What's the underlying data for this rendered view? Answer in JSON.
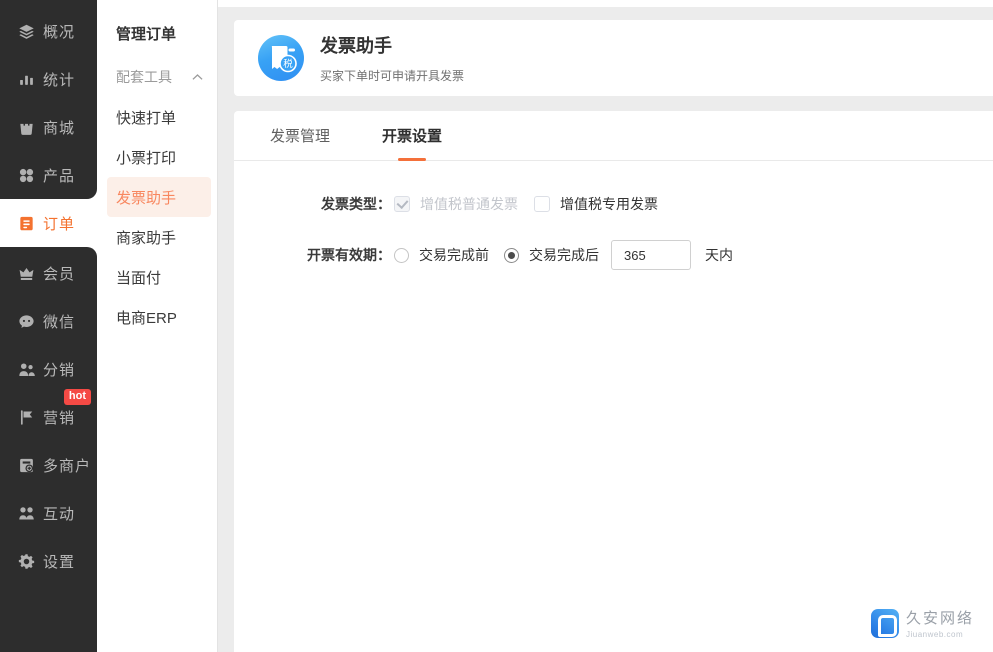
{
  "sidebar": {
    "items": [
      {
        "label": "概况",
        "icon": "layers-icon"
      },
      {
        "label": "统计",
        "icon": "stats-icon"
      },
      {
        "label": "商城",
        "icon": "mall-icon"
      },
      {
        "label": "产品",
        "icon": "products-icon"
      },
      {
        "label": "订单",
        "icon": "orders-icon",
        "active": true
      },
      {
        "label": "会员",
        "icon": "crown-icon"
      },
      {
        "label": "微信",
        "icon": "wechat-icon"
      },
      {
        "label": "分销",
        "icon": "distribution-icon"
      },
      {
        "label": "营销",
        "icon": "flag-icon",
        "badge": "hot"
      },
      {
        "label": "多商户",
        "icon": "multistore-icon"
      },
      {
        "label": "互动",
        "icon": "interact-icon"
      },
      {
        "label": "设置",
        "icon": "gear-icon"
      }
    ]
  },
  "submenu": {
    "header": "管理订单",
    "section": {
      "label": "配套工具",
      "collapse_icon": "chevron-up-icon"
    },
    "items": [
      {
        "label": "快速打单"
      },
      {
        "label": "小票打印"
      },
      {
        "label": "发票助手",
        "active": true
      },
      {
        "label": "商家助手"
      },
      {
        "label": "当面付"
      },
      {
        "label": "电商ERP"
      }
    ]
  },
  "header_card": {
    "icon": "invoice-tax-icon",
    "icon_badge_char": "税",
    "title": "发票助手",
    "subtitle": "买家下单时可申请开具发票"
  },
  "tabs": [
    {
      "label": "发票管理",
      "active": false
    },
    {
      "label": "开票设置",
      "active": true
    }
  ],
  "form": {
    "invoice_type": {
      "label": "发票类型：",
      "options": [
        {
          "label": "增值税普通发票",
          "checked": true,
          "disabled": true
        },
        {
          "label": "增值税专用发票",
          "checked": false,
          "disabled": false
        }
      ]
    },
    "validity": {
      "label": "开票有效期：",
      "options": [
        {
          "label": "交易完成前",
          "checked": false
        },
        {
          "label": "交易完成后",
          "checked": true
        }
      ],
      "days_value": "365",
      "suffix": "天内"
    }
  },
  "footer_logo": {
    "name": "久安网络",
    "domain": "Jiuanweb.com"
  },
  "colors": {
    "accent": "#f4722f",
    "accent_light": "#f8875f",
    "accent_bg": "#fcefe8",
    "hot_badge": "#f54a45",
    "sidebar_bg": "#2d2d2d",
    "icon_blue_top": "#63c3f8",
    "icon_blue_bottom": "#2f8ef2"
  }
}
